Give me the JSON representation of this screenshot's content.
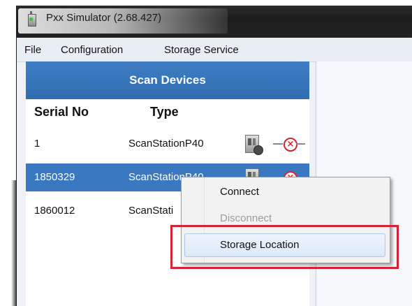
{
  "window": {
    "title": "Pxx Simulator (2.68.427)"
  },
  "menubar": {
    "items": [
      "File",
      "Configuration",
      "Storage Service"
    ]
  },
  "panel": {
    "title": "Scan Devices",
    "columns": {
      "serial": "Serial No",
      "type": "Type"
    },
    "rows": [
      {
        "serial": "1",
        "type": "ScanStationP40"
      },
      {
        "serial": "1850329",
        "type": "ScanStationP40"
      },
      {
        "serial": "1860012",
        "type": "ScanStati"
      }
    ]
  },
  "context_menu": {
    "items": [
      {
        "label": "Connect",
        "enabled": true
      },
      {
        "label": "Disconnect",
        "enabled": false
      },
      {
        "label": "Storage Location",
        "enabled": true
      }
    ]
  },
  "colors": {
    "header_blue": "#2f6cb0",
    "selection_blue": "#3a78c2",
    "highlight_red": "#d42237",
    "disconnect_red": "#d8232a"
  },
  "icons": [
    "app-icon",
    "scanner-device-icon",
    "disconnected-icon"
  ]
}
